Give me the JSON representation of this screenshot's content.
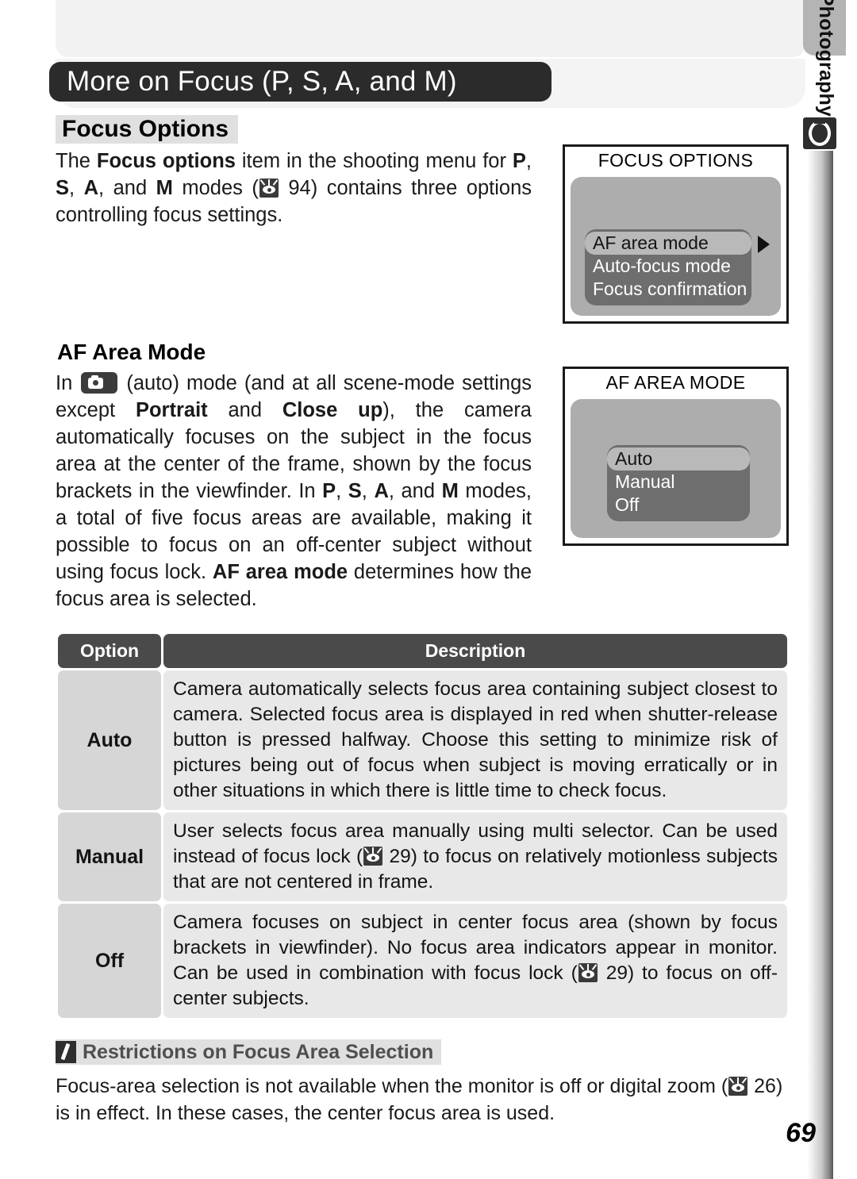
{
  "header": {
    "chapter_title": "More on Focus (P, S, A, and M)",
    "section_title": "Focus Options"
  },
  "side_tab": {
    "label": "More on Photography",
    "icon": "camera-icon"
  },
  "intro": {
    "p1_a": "The ",
    "p1_b": "Focus options",
    "p1_c": " item in the shooting menu for ",
    "p1_d": "P",
    "p1_e": ", ",
    "p1_f": "S",
    "p1_g": ", ",
    "p1_h": "A",
    "p1_i": ", and ",
    "p1_j": "M",
    "p1_k": " modes (",
    "p1_ref": "94",
    "p1_l": ") contains three options controlling focus settings."
  },
  "lcd_focus_options": {
    "title": "FOCUS OPTIONS",
    "items": [
      {
        "label": "AF area mode",
        "selected": true
      },
      {
        "label": "Auto-focus mode",
        "selected": false
      },
      {
        "label": "Focus confirmation",
        "selected": false
      }
    ],
    "caret": "caret-right-icon"
  },
  "af_area_mode": {
    "heading": "AF Area Mode",
    "t1": "In ",
    "t2": " (auto) mode (and at all scene-mode settings except ",
    "b1": "Portrait",
    "t3": " and ",
    "b2": "Close up",
    "t4": "), the camera automatically focuses on the subject in the focus area at the center of the frame, shown by the focus brackets in the viewfinder.  In ",
    "b3": "P",
    "t5": ", ",
    "b4": "S",
    "t6": ", ",
    "b5": "A",
    "t7": ", and ",
    "b6": "M",
    "t8": " modes, a total of five focus areas are available, making it possible to focus on an off-center subject without using focus lock.  ",
    "b7": "AF area mode",
    "t9": " determines how the focus area is selected."
  },
  "lcd_af_area_mode": {
    "title": "AF AREA MODE",
    "items": [
      {
        "label": "Auto",
        "selected": true
      },
      {
        "label": "Manual",
        "selected": false
      },
      {
        "label": "Off",
        "selected": false
      }
    ],
    "enter_icon": "enter-arrow-icon"
  },
  "table": {
    "headers": [
      "Option",
      "Description"
    ],
    "rows": [
      {
        "option": "Auto",
        "description": "Camera automatically selects focus area containing subject closest to camera.  Selected focus area is displayed in red when shutter-release button is pressed halfway.  Choose this setting to minimize risk of pictures being out of focus when subject is moving erratically or in other situations in which there is little time to check focus."
      },
      {
        "option": "Manual",
        "desc_a": "User selects focus area manually using multi selector.  Can be used instead of focus lock (",
        "desc_ref": "29",
        "desc_b": ") to focus on relatively motionless subjects that are not centered in frame."
      },
      {
        "option": "Off",
        "desc_a": "Camera focuses on subject in center focus area (shown by focus brackets in viewfinder).  No focus area indicators appear in monitor.  Can be used in combination with focus lock (",
        "desc_ref": "29",
        "desc_b": ") to focus on off-center subjects."
      }
    ]
  },
  "note": {
    "icon": "pencil-icon",
    "title": "Restrictions on Focus Area Selection",
    "body_a": "Focus-area selection is not available when the monitor is off or digital zoom (",
    "body_ref": "26",
    "body_b": ") is in effect.  In these cases, the center focus area is used."
  },
  "footer": {
    "page_number": "69"
  },
  "colors": {
    "chapter_pill_bg": "#2b2b2b",
    "heading_highlight": "#e0e0e0",
    "table_header_bg": "#4a4a4a",
    "table_option_bg": "#d6d6d6",
    "table_desc_bg": "#e8e8e8",
    "lcd_body_bg": "#adadad",
    "lcd_menu_bg": "#6e6e6e",
    "lcd_selected_bg": "#b9b9b9"
  }
}
